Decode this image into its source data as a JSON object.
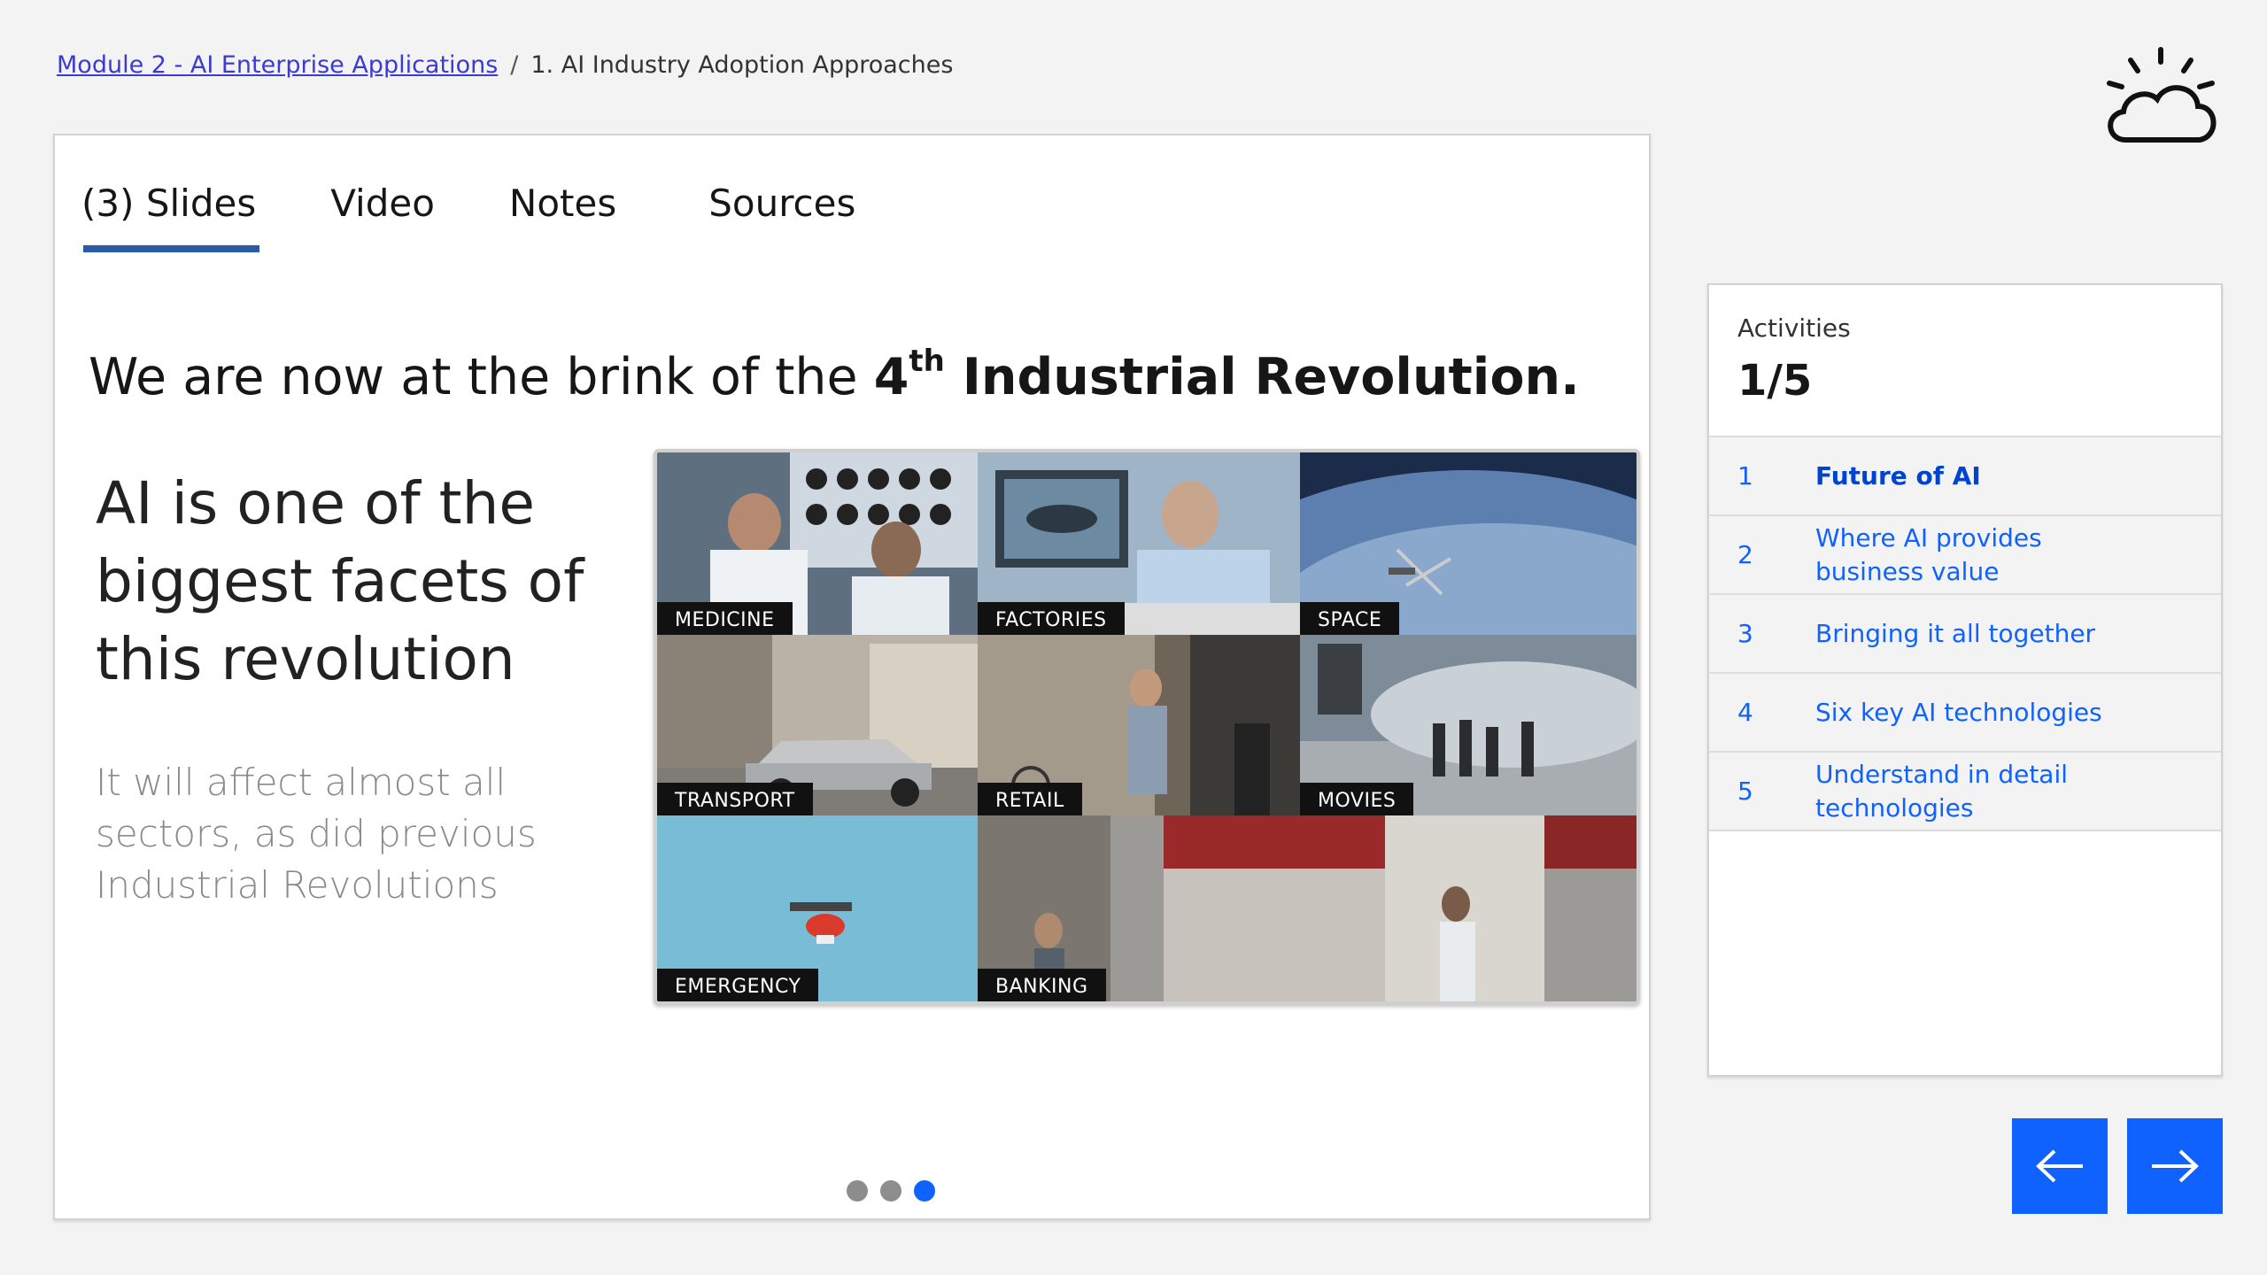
{
  "breadcrumb": {
    "module_link": "Module 2 - AI Enterprise Applications",
    "separator": "/",
    "current": "1. AI Industry Adoption Approaches"
  },
  "tabs": [
    {
      "label": "(3) Slides",
      "active": true
    },
    {
      "label": "Video",
      "active": false
    },
    {
      "label": "Notes",
      "active": false
    },
    {
      "label": "Sources",
      "active": false
    }
  ],
  "slide": {
    "headline_pre": "We are now at the brink of the ",
    "headline_num": "4",
    "headline_sup": "th",
    "headline_bold": " Industrial Revolution.",
    "lead": "AI is one of the biggest facets of this revolution",
    "sub": "It will affect almost all sectors, as did previous Industrial Revolutions",
    "collage_labels": [
      "MEDICINE",
      "FACTORIES",
      "SPACE",
      "TRANSPORT",
      "RETAIL",
      "MOVIES",
      "EMERGENCY",
      "BANKING"
    ],
    "pager": {
      "total": 3,
      "current": 3
    }
  },
  "activities": {
    "title": "Activities",
    "count": "1/5",
    "items": [
      {
        "num": "1",
        "label": "Future of AI",
        "active": true
      },
      {
        "num": "2",
        "label": "Where AI provides business value",
        "active": false
      },
      {
        "num": "3",
        "label": "Bringing it all together",
        "active": false
      },
      {
        "num": "4",
        "label": "Six key AI technologies",
        "active": false
      },
      {
        "num": "5",
        "label": "Understand in detail technologies",
        "active": false
      }
    ]
  },
  "nav": {
    "prev_icon": "arrow-left-icon",
    "next_icon": "arrow-right-icon"
  },
  "colors": {
    "accent": "#0f62fe",
    "tab_underline": "#2a5ba8",
    "background": "#f3f3f3"
  }
}
